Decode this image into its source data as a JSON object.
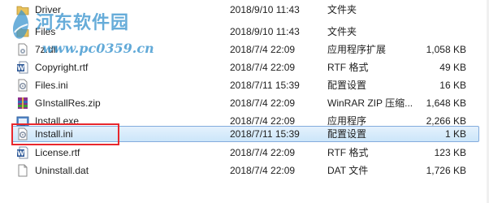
{
  "files": [
    {
      "icon": "folder-icon",
      "name": "Driver",
      "date": "2018/9/10 11:43",
      "type": "文件夹",
      "size": ""
    },
    {
      "icon": "folder-icon",
      "name": "Files",
      "date": "2018/9/10 11:43",
      "type": "文件夹",
      "size": ""
    },
    {
      "icon": "dll-file-icon",
      "name": "7z.dll",
      "date": "2018/7/4 22:09",
      "type": "应用程序扩展",
      "size": "1,058 KB"
    },
    {
      "icon": "rtf-file-icon",
      "name": "Copyright.rtf",
      "date": "2018/7/4 22:09",
      "type": "RTF 格式",
      "size": "49 KB"
    },
    {
      "icon": "ini-file-icon",
      "name": "Files.ini",
      "date": "2018/7/11 15:39",
      "type": "配置设置",
      "size": "16 KB"
    },
    {
      "icon": "zip-file-icon",
      "name": "GInstallRes.zip",
      "date": "2018/7/4 22:09",
      "type": "WinRAR ZIP 压缩...",
      "size": "1,648 KB"
    },
    {
      "icon": "exe-file-icon",
      "name": "Install.exe",
      "date": "2018/7/4 22:09",
      "type": "应用程序",
      "size": "2,266 KB"
    },
    {
      "icon": "ini-file-icon",
      "name": "Install.ini",
      "date": "2018/7/11 15:39",
      "type": "配置设置",
      "size": "1 KB"
    },
    {
      "icon": "rtf-file-icon",
      "name": "License.rtf",
      "date": "2018/7/4 22:09",
      "type": "RTF 格式",
      "size": "123 KB"
    },
    {
      "icon": "dat-file-icon",
      "name": "Uninstall.dat",
      "date": "2018/7/4 22:09",
      "type": "DAT 文件",
      "size": "1,726 KB"
    }
  ],
  "watermark": {
    "title": "河东软件园",
    "url": "www.pc0359.cn"
  },
  "colors": {
    "selection": "#cce6fa",
    "highlight": "#e8282d",
    "watermark": "#3c95cf"
  }
}
